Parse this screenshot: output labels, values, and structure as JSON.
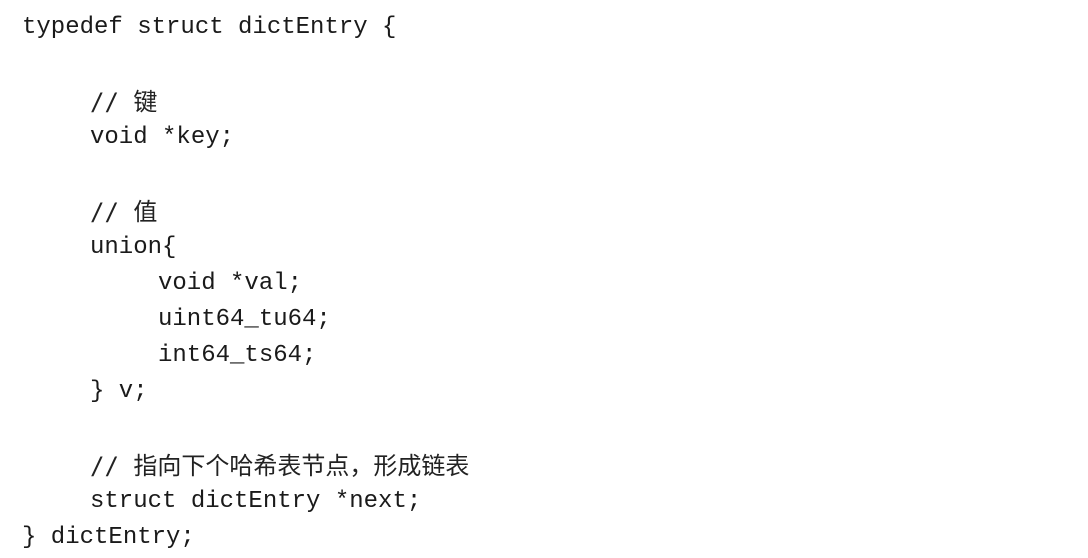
{
  "code": {
    "lines": [
      "typedef struct dictEntry {",
      "// 键",
      "void *key;",
      "// 值",
      "union{",
      "void *val;",
      "uint64_tu64;",
      "int64_ts64;",
      "} v;",
      "// 指向下个哈希表节点，形成链表",
      "struct dictEntry *next;",
      "} dictEntry;"
    ]
  }
}
